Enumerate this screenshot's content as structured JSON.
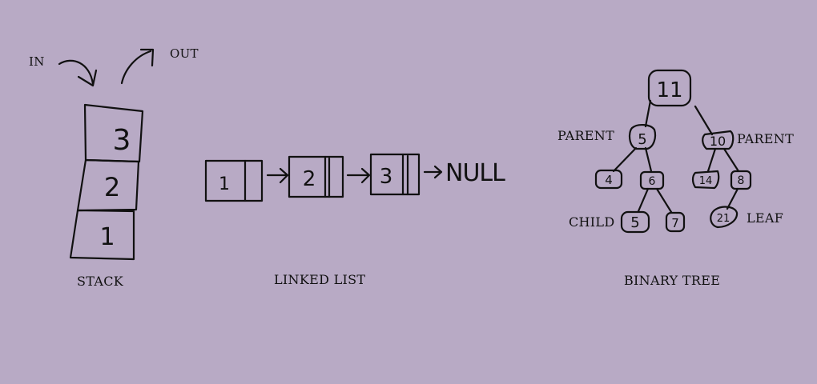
{
  "stack": {
    "in_label": "IN",
    "out_label": "OUT",
    "items": [
      "3",
      "2",
      "1"
    ],
    "caption": "STACK"
  },
  "linked_list": {
    "nodes": [
      "1",
      "2",
      "3"
    ],
    "terminator": "NULL",
    "caption": "LINKED LIST"
  },
  "binary_tree": {
    "root": "11",
    "level1": [
      "5",
      "10"
    ],
    "level2": [
      "4",
      "6",
      "14",
      "8"
    ],
    "level3": [
      "5",
      "7",
      "21"
    ],
    "labels": {
      "parent_left": "PARENT",
      "parent_right": "PARENT",
      "child": "CHILD",
      "leaf": "LEAF"
    },
    "caption": "BINARY TREE"
  },
  "colors": {
    "background": "#b8aac5",
    "ink": "#111111"
  }
}
